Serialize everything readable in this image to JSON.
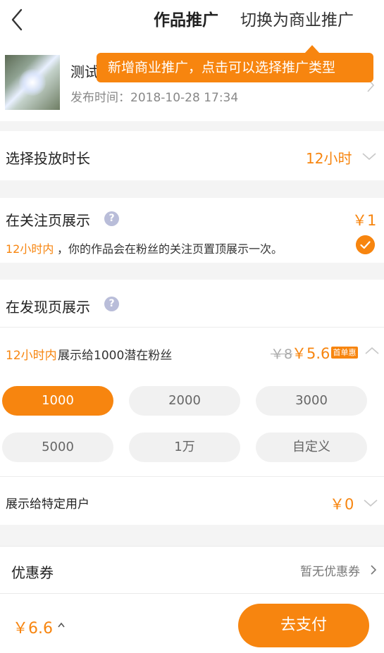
{
  "header": {
    "title": "作品推广",
    "switch_label": "切换为商业推广"
  },
  "work": {
    "name": "测试",
    "publish_time": "发布时间：2018-10-28 17:34"
  },
  "tooltip": {
    "text": "新增商业推广，点击可以选择推广类型"
  },
  "duration": {
    "label": "选择投放时长",
    "value": "12小时"
  },
  "follow": {
    "title": "在关注页展示",
    "help": "?",
    "price": "￥1",
    "desc_highlight": "12小时内",
    "desc": "，你的作品会在粉丝的关注页置顶展示一次。",
    "checked": true
  },
  "discover": {
    "title": "在发现页展示",
    "help": "?",
    "desc_highlight": "12小时内",
    "desc": "展示给1000潜在粉丝",
    "old_price": "￥8",
    "new_price": "￥5.6",
    "badge": "首单惠",
    "options": [
      "1000",
      "2000",
      "3000",
      "5000",
      "1万",
      "自定义"
    ],
    "selected_option": "1000",
    "specific_label": "展示给特定用户",
    "specific_price": "￥0"
  },
  "coupon": {
    "label": "优惠券",
    "value": "暂无优惠券"
  },
  "footer": {
    "total": "￥6.6",
    "pay_label": "去支付"
  },
  "colors": {
    "accent": "#f7850f",
    "help_icon": "#b9bdd9",
    "chip_bg": "#f1f1f1"
  }
}
